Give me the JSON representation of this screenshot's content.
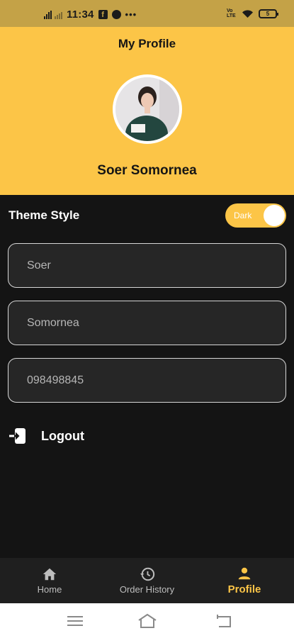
{
  "status_bar": {
    "time": "11:34",
    "dots": "•••",
    "network_tag": "Vo LTE",
    "battery": "5"
  },
  "header": {
    "title": "My Profile",
    "user_name": "Soer Somornea"
  },
  "theme": {
    "label": "Theme Style",
    "toggle_text": "Dark",
    "is_on": true
  },
  "form": {
    "first_name": "Soer",
    "last_name": "Somornea",
    "phone": "098498845"
  },
  "logout": {
    "label": "Logout",
    "icon": "logout-icon"
  },
  "bottom_nav": {
    "items": [
      {
        "label": "Home",
        "icon": "home-icon",
        "active": false
      },
      {
        "label": "Order History",
        "icon": "history-icon",
        "active": false
      },
      {
        "label": "Profile",
        "icon": "person-icon",
        "active": true
      }
    ]
  },
  "colors": {
    "accent": "#fcc547",
    "background": "#141414",
    "field_background": "#262626",
    "nav_background": "#1f1f1f"
  }
}
